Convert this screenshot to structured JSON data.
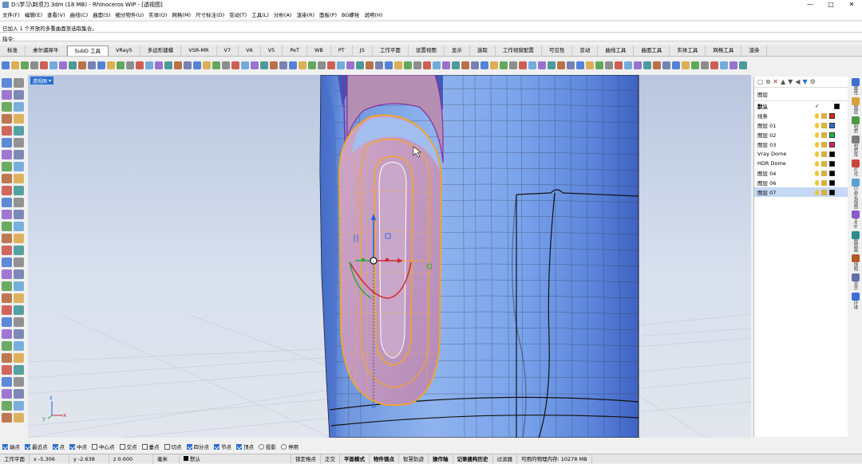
{
  "window": {
    "title": "D:\\学习\\剃须刀.3dm (18 MB) - Rhinoceros WIP - [透视图]"
  },
  "menu": [
    "文件(F)",
    "编辑(E)",
    "查看(V)",
    "曲线(C)",
    "曲面(S)",
    "细分物件(U)",
    "实体(O)",
    "网格(M)",
    "尺寸标注(D)",
    "变动(T)",
    "工具(L)",
    "分析(A)",
    "渲染(R)",
    "面板(P)",
    "BG螺栓",
    "说明(H)"
  ],
  "command": {
    "history": "已加入 1 个开放的多重曲面至选取集合。",
    "prompt": "指令:"
  },
  "tabs": [
    "标准",
    "桌尔逼犀牛",
    "SubD 工具",
    "VRay5",
    "多边形建模",
    "VSR-MR",
    "V7",
    "V6",
    "V5",
    "PeT",
    "WB",
    "PT",
    "JS",
    "工作平面",
    "设置视图",
    "显示",
    "选取",
    "工作视窗配置",
    "可见性",
    "变动",
    "曲线工具",
    "曲面工具",
    "实体工具",
    "网格工具",
    "渲染"
  ],
  "active_tab": "SubD 工具",
  "viewport": {
    "label": "透视图",
    "axis_x": "x",
    "axis_y": "y",
    "axis_z": "z"
  },
  "layers": {
    "header": "图层",
    "rows": [
      {
        "name": "默认",
        "check": "✓",
        "color": "#000000",
        "current": true
      },
      {
        "name": "线条",
        "color": "#e0201a"
      },
      {
        "name": "图层 01",
        "color": "#2a6ed8"
      },
      {
        "name": "图层 02",
        "color": "#1fb34a"
      },
      {
        "name": "图层 03",
        "color": "#e0206a"
      },
      {
        "name": "Vray Dome",
        "color": "#000000"
      },
      {
        "name": "HDR Dome",
        "color": "#000000"
      },
      {
        "name": "图层 04",
        "color": "#000000"
      },
      {
        "name": "图层 06",
        "color": "#000000"
      },
      {
        "name": "图层 07",
        "color": "#000000",
        "selected": true
      }
    ]
  },
  "right_panels": [
    "属性",
    "图层",
    "材质",
    "材质库",
    "灯光",
    "已命名视图",
    "Help",
    "图层面",
    "快照",
    "显示",
    "环境"
  ],
  "osnap": [
    {
      "label": "端点",
      "on": true
    },
    {
      "label": "最近点",
      "on": true
    },
    {
      "label": "点",
      "on": true
    },
    {
      "label": "中点",
      "on": true
    },
    {
      "label": "中心点",
      "on": false
    },
    {
      "label": "交点",
      "on": false
    },
    {
      "label": "垂点",
      "on": false
    },
    {
      "label": "切点",
      "on": false
    },
    {
      "label": "四分点",
      "on": true
    },
    {
      "label": "节点",
      "on": true
    },
    {
      "label": "顶点",
      "on": true
    },
    {
      "label": "投影",
      "on": false,
      "radio": true
    },
    {
      "label": "停用",
      "on": false,
      "radio": true
    }
  ],
  "status": {
    "cplane": "工作平面",
    "x": "x -5.306",
    "y": "y -2.638",
    "z": "z 0.000",
    "units": "毫米",
    "layer": "默认",
    "items": [
      "锁定格点",
      "正交",
      "平面模式",
      "物件锁点",
      "智慧轨迹",
      "操作轴",
      "记录建构历史",
      "过滤器"
    ],
    "bold_items": [
      "平面模式",
      "物件锁点",
      "操作轴",
      "记录建构历史"
    ],
    "memory": "可用的物理内存: 10278 MB"
  }
}
